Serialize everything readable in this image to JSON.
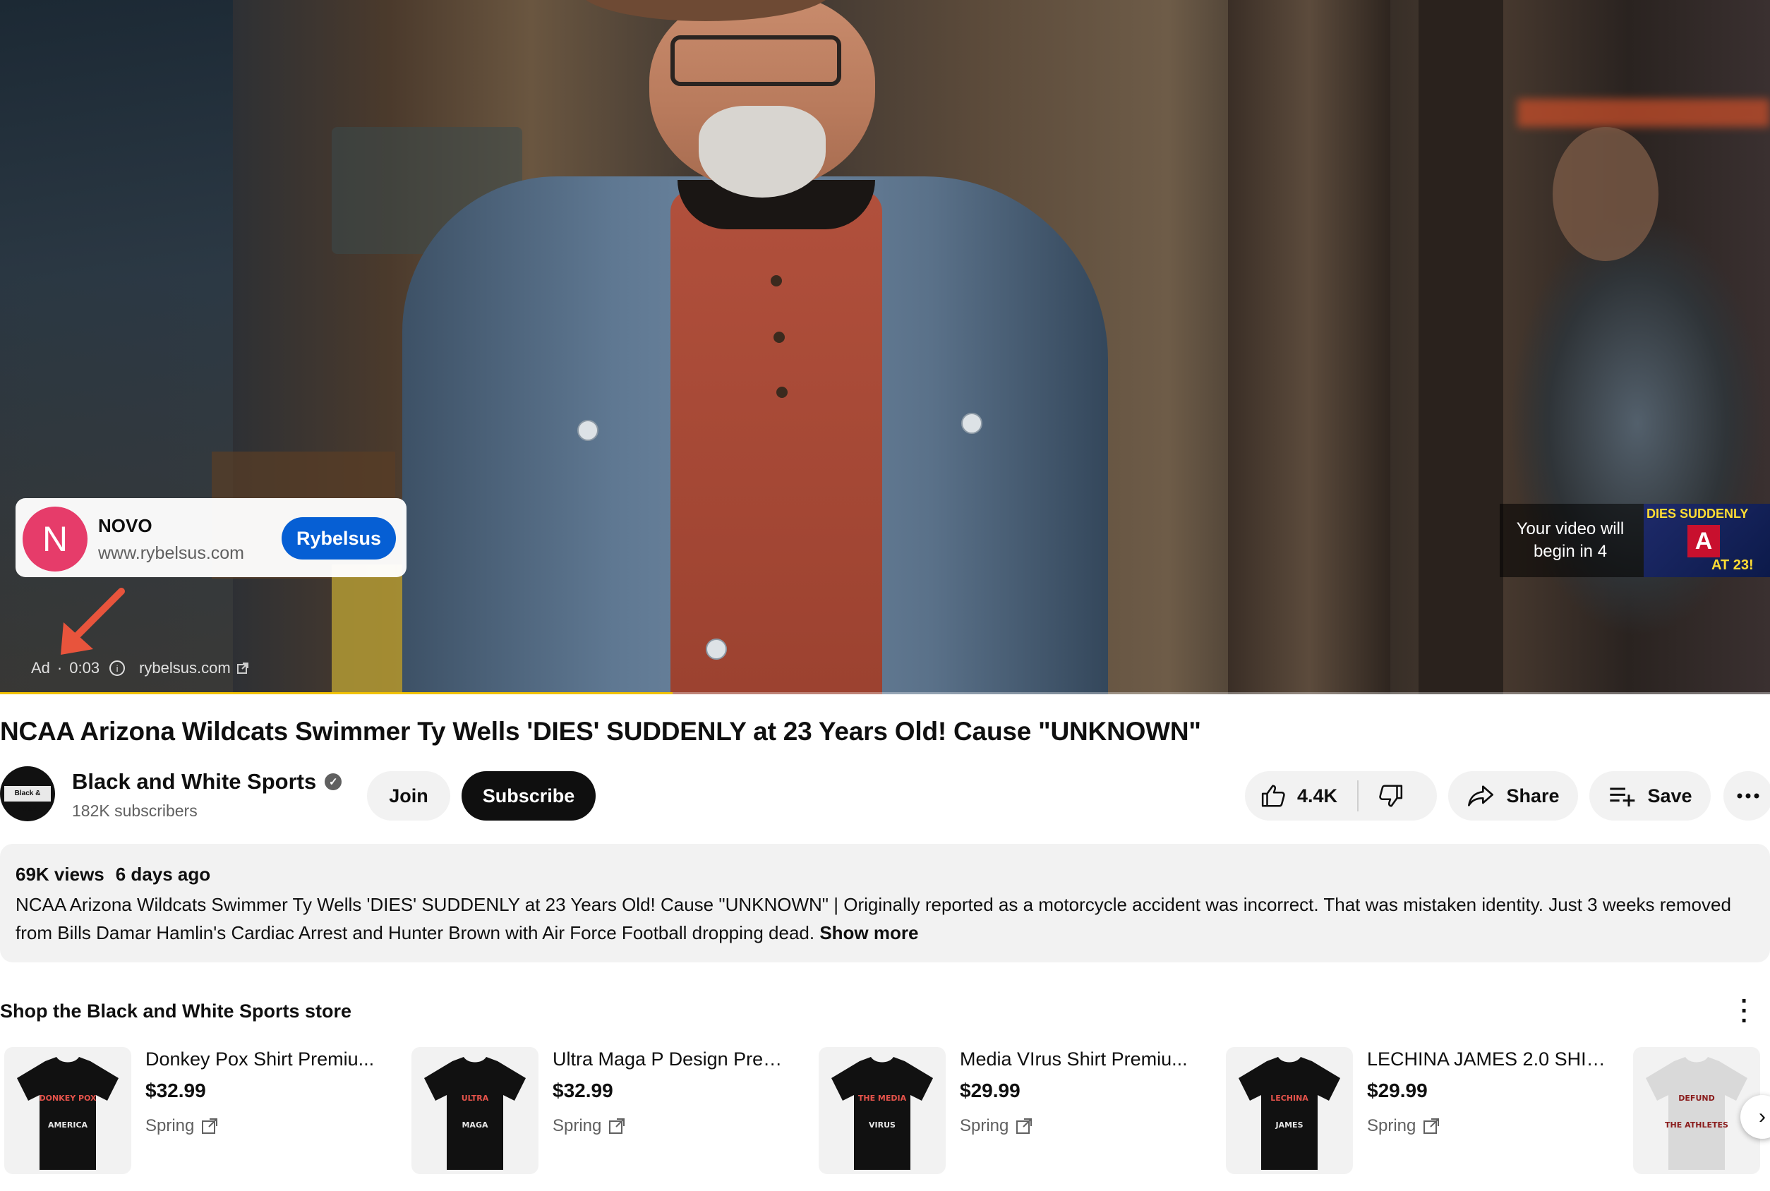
{
  "ad": {
    "avatar_letter": "N",
    "advertiser": "NOVO",
    "url": "www.rybelsus.com",
    "cta": "Rybelsus",
    "badge": "Ad",
    "time": "0:03",
    "domain": "rybelsus.com",
    "progress_fraction": 0.38
  },
  "up_next": {
    "text": "Your video will begin in 4",
    "thumb_top": "DIES SUDDENLY",
    "thumb_logo": "A",
    "thumb_bottom": "AT 23!"
  },
  "video": {
    "title": "NCAA Arizona Wildcats Swimmer Ty Wells 'DIES' SUDDENLY at 23 Years Old! Cause \"UNKNOWN\""
  },
  "channel": {
    "avatar_text": "Black & White",
    "name": "Black and White Sports",
    "subscribers": "182K subscribers",
    "join_label": "Join",
    "subscribe_label": "Subscribe"
  },
  "actions": {
    "likes": "4.4K",
    "share_label": "Share",
    "save_label": "Save"
  },
  "description": {
    "views": "69K views",
    "age": "6 days ago",
    "text": "NCAA Arizona Wildcats Swimmer Ty Wells 'DIES' SUDDENLY at 23 Years Old! Cause \"UNKNOWN\" | Originally reported as a motorcycle accident was incorrect.  That was mistaken identity. Just 3 weeks removed from Bills Damar Hamlin's Cardiac Arrest and Hunter Brown with Air Force Football dropping dead.",
    "show_more": "Show more"
  },
  "store": {
    "title": "Shop the Black and White Sports store",
    "items": [
      {
        "name": "Donkey Pox Shirt Premiu...",
        "price": "$32.99",
        "vendor": "Spring",
        "shirt_color": "#111111",
        "shirt_text": "DONKEY POX",
        "shirt_text2": "AMERICA"
      },
      {
        "name": "Ultra Maga P Design Prem...",
        "price": "$32.99",
        "vendor": "Spring",
        "shirt_color": "#111111",
        "shirt_text": "ULTRA",
        "shirt_text2": "MAGA"
      },
      {
        "name": "Media VIrus Shirt Premiu...",
        "price": "$29.99",
        "vendor": "Spring",
        "shirt_color": "#111111",
        "shirt_text": "THE MEDIA",
        "shirt_text2": "VIRUS"
      },
      {
        "name": "LECHINA JAMES 2.0 SHIR...",
        "price": "$29.99",
        "vendor": "Spring",
        "shirt_color": "#111111",
        "shirt_text": "LECHINA",
        "shirt_text2": "JAMES"
      },
      {
        "name": "",
        "price": "",
        "vendor": "",
        "shirt_color": "#d9d9d9",
        "shirt_text": "DEFUND",
        "shirt_text2": "THE ATHLETES"
      }
    ]
  },
  "colors": {
    "accent": "#065fd4",
    "progress": "#f2c200",
    "ad_avatar": "#e63c6a"
  }
}
